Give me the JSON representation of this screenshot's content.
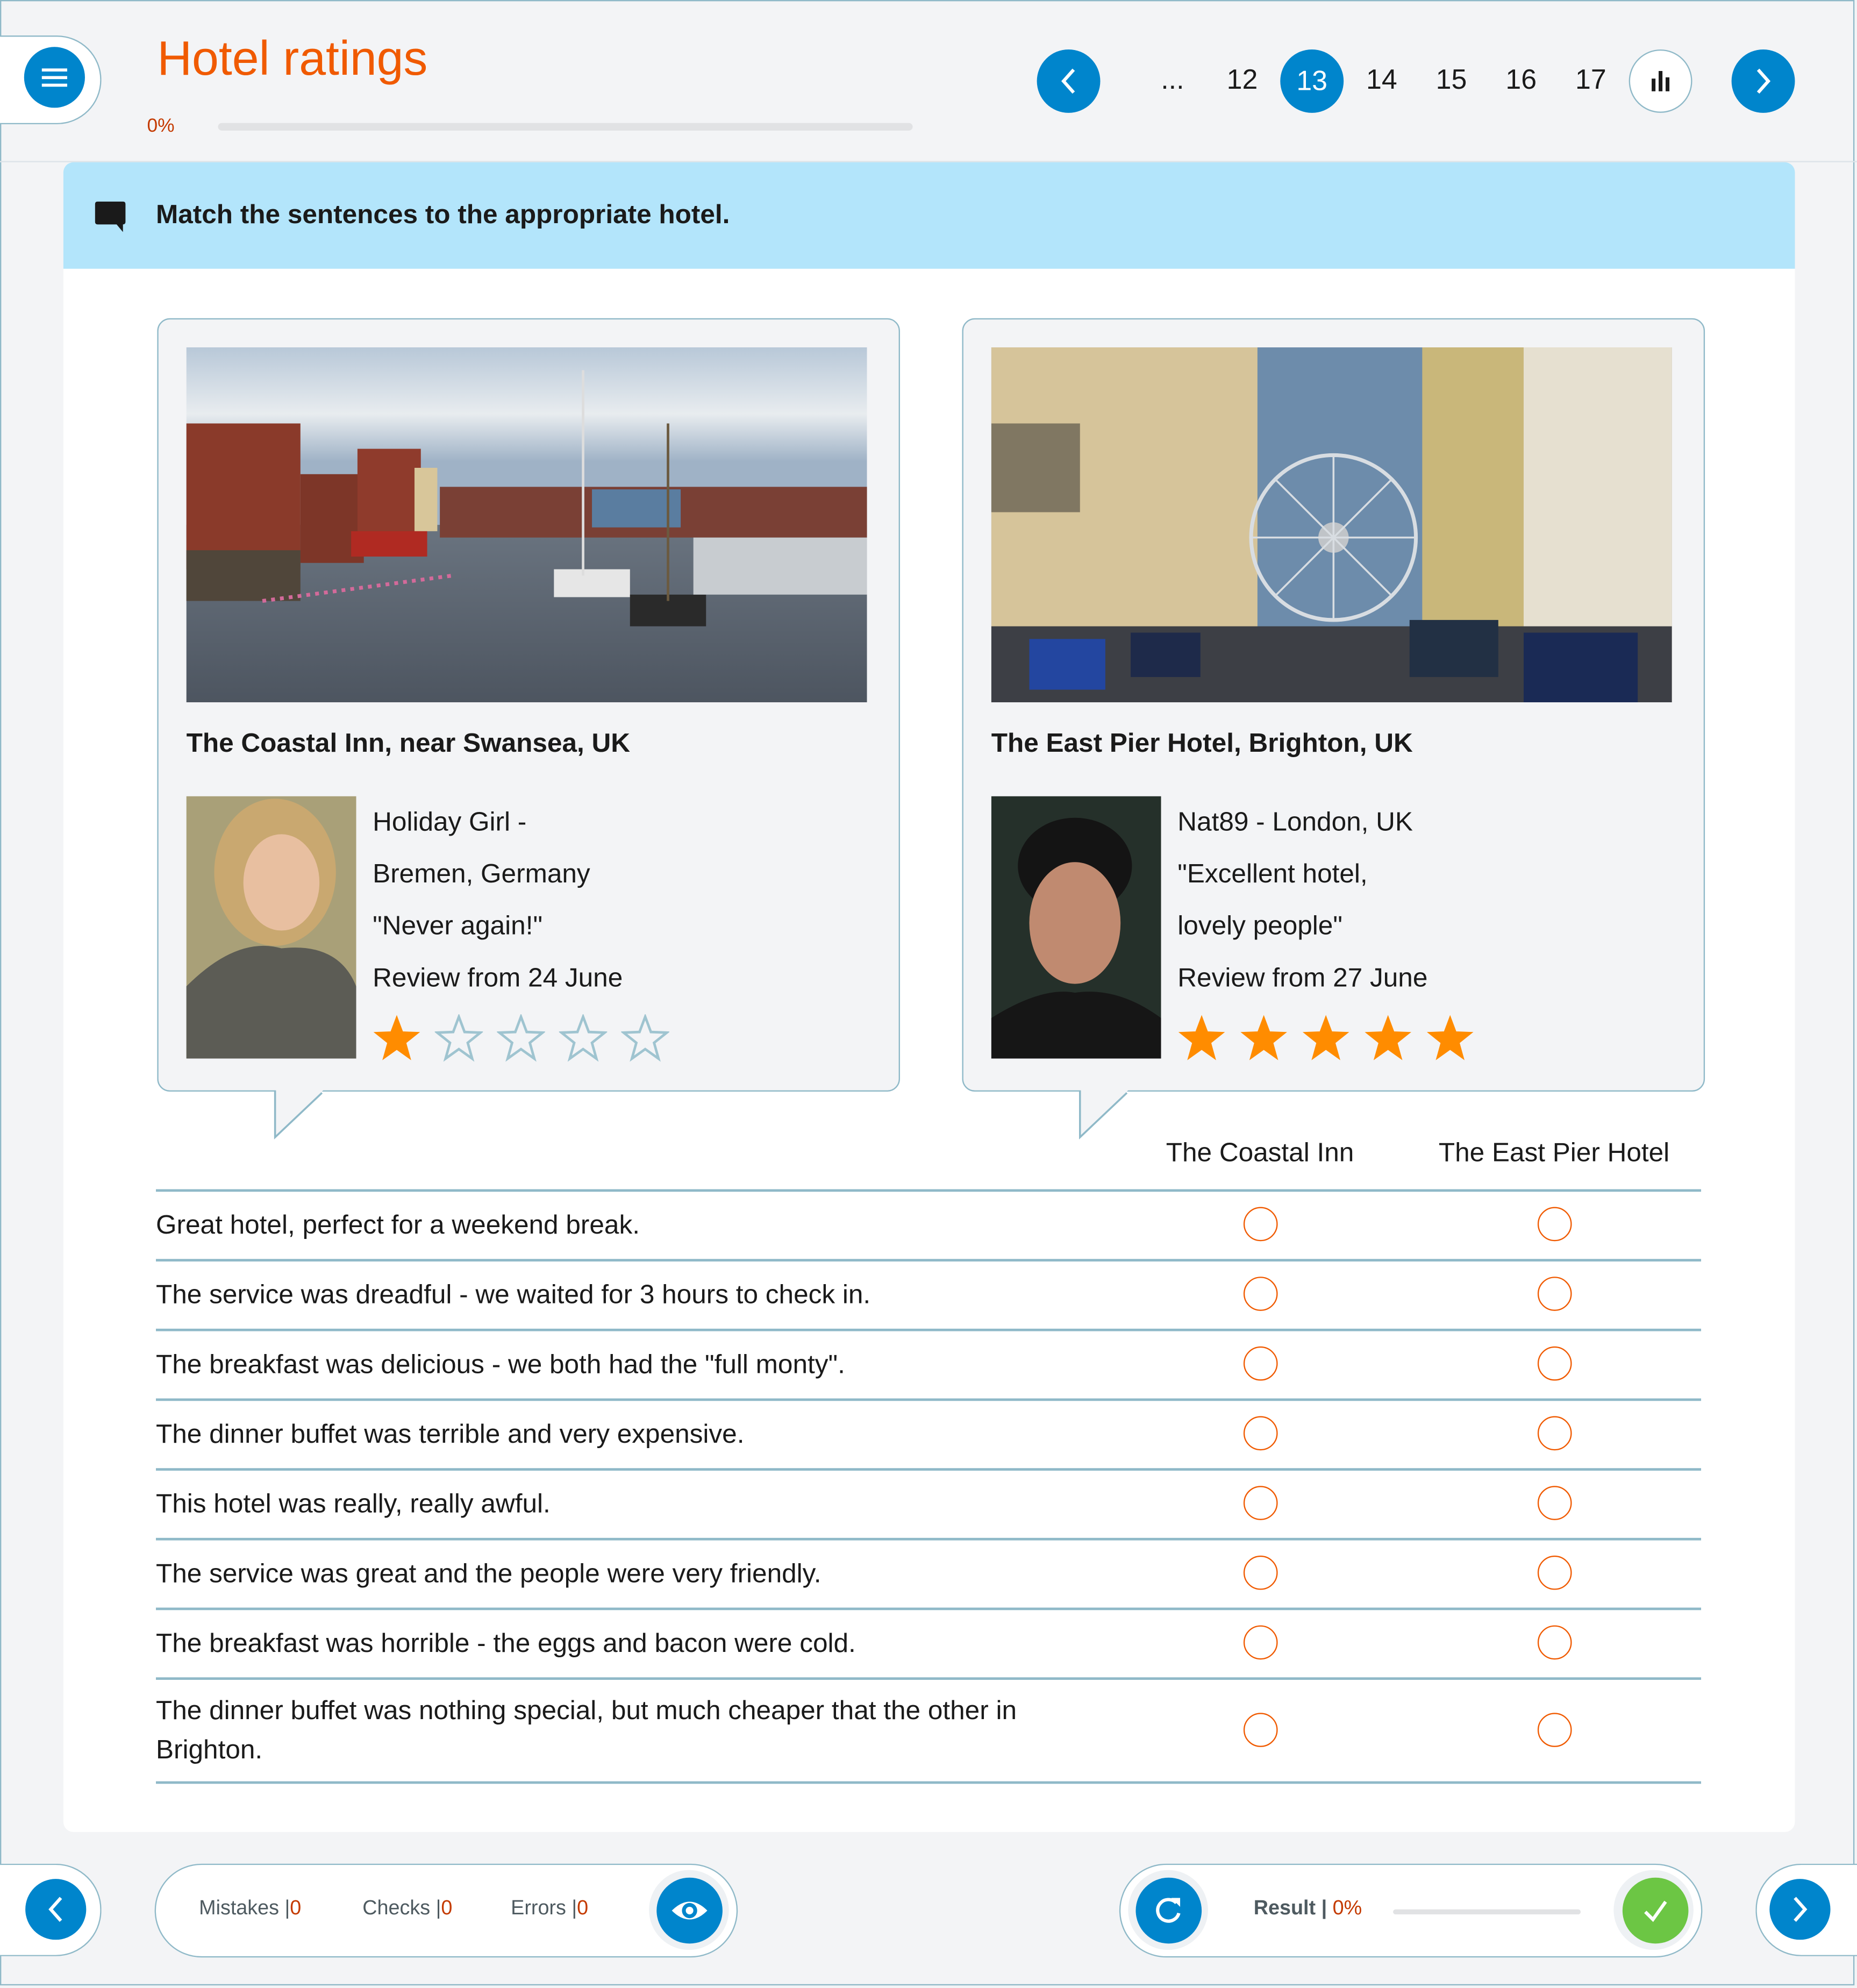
{
  "header": {
    "title": "Hotel ratings",
    "progress_label": "0%",
    "progress_value": 0,
    "menu_icon": "hamburger-menu-icon"
  },
  "pager": {
    "ellipsis": "...",
    "pages": [
      "12",
      "13",
      "14",
      "15",
      "16",
      "17"
    ],
    "current_page": "13",
    "prev_icon": "chevron-left-icon",
    "next_icon": "chevron-right-icon",
    "stats_icon": "bar-chart-icon"
  },
  "instruction": {
    "icon": "speech-bubble-icon",
    "text": "Match the sentences to the appropriate hotel."
  },
  "hotels": [
    {
      "name": "The Coastal Inn, near Swansea, UK",
      "image": "marina-harbour-photo",
      "avatar": "reviewer-woman-photo",
      "review_lines": [
        "Holiday Girl -",
        "Bremen, Germany",
        "\"Never again!\"",
        "Review from 24 June"
      ],
      "rating": 1,
      "max_rating": 5
    },
    {
      "name": "The East Pier Hotel, Brighton, UK",
      "image": "brighton-street-ferris-wheel-photo",
      "avatar": "reviewer-man-photo",
      "review_lines": [
        "Nat89 - London, UK",
        "\"Excellent hotel,",
        "lovely people\"",
        "Review from 27 June"
      ],
      "rating": 5,
      "max_rating": 5
    }
  ],
  "matching": {
    "columns": [
      "The Coastal Inn",
      "The East Pier Hotel"
    ],
    "rows": [
      "Great hotel, perfect for a weekend break.",
      "The service was dreadful - we waited for 3 hours to check in.",
      "The breakfast was delicious - we both had the \"full monty\".",
      "The dinner buffet was terrible and very expensive.",
      "This hotel was really, really awful.",
      "The service was great and the people were very friendly.",
      "The breakfast was horrible - the eggs and bacon were cold.",
      "The dinner buffet was nothing special, but much cheaper that the other in Brighton."
    ]
  },
  "footer": {
    "mistakes_label": "Mistakes",
    "mistakes_value": "0",
    "checks_label": "Checks",
    "checks_value": "0",
    "errors_label": "Errors",
    "errors_value": "0",
    "separator": "|",
    "result_label": "Result",
    "result_value": "0%",
    "result_progress": 0,
    "eye_icon": "eye-icon",
    "reset_icon": "refresh-icon",
    "check_icon": "checkmark-icon"
  },
  "colors": {
    "accent_blue": "#0085cc",
    "title_orange": "#f05a00",
    "value_red": "#c43a00",
    "instruction_bg": "#b3e5fb",
    "border_blue_gray": "#8fb9c8",
    "star_filled": "#ff8c00",
    "star_empty": "#9fc4d0",
    "check_green": "#6cc644"
  }
}
